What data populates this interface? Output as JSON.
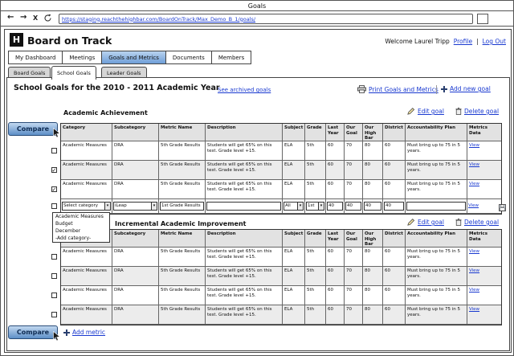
{
  "browser": {
    "window_title": "Goals",
    "url": "https://staging.reachthehighbar.com/BoardOnTrack/Max_Demo_B_1/goals/",
    "back_glyph": "←",
    "forward_glyph": "→",
    "close_glyph": "X"
  },
  "header": {
    "logo": "H",
    "app_title": "Board on Track",
    "welcome": "Welcome Laurel Tripp",
    "profile": "Profile",
    "separator": "|",
    "logout": "Log Out"
  },
  "nav": {
    "items": [
      {
        "label": "My Dashboard",
        "active": false
      },
      {
        "label": "Meetings",
        "active": false
      },
      {
        "label": "Goals and Metrics",
        "active": true
      },
      {
        "label": "Documents",
        "active": false
      },
      {
        "label": "Members",
        "active": false
      }
    ]
  },
  "subtabs": {
    "items": [
      {
        "label": "Board Goals",
        "active": false
      },
      {
        "label": "School Goals",
        "active": true
      },
      {
        "label": "Leader Goals",
        "active": false
      }
    ]
  },
  "page": {
    "title": "School Goals for the 2010 - 2011 Academic Year",
    "archived_link": "See archived goals",
    "print_link": "Print Goals and Metrics",
    "add_goal_link": "Add new goal"
  },
  "columns": [
    "Category",
    "Subcategory",
    "Metric Name",
    "Description",
    "Subject",
    "Grade",
    "Last Year",
    "Our Goal",
    "Our High Bar",
    "District",
    "Accountability Plan",
    "Metrics Data"
  ],
  "sections": [
    {
      "title": "Academic Achievement",
      "edit_link": "Edit goal",
      "delete_link": "Delete goal",
      "checks": [
        false,
        true,
        true,
        false
      ],
      "rows": [
        {
          "cells": [
            "Academic Measures",
            "DRA",
            "5th Grade Results",
            "Students will get 65% on this test. Grade level +15.",
            "ELA",
            "5th",
            "60",
            "70",
            "80",
            "60",
            "Must bring up to 75 in 5 years.",
            "View"
          ]
        },
        {
          "cells": [
            "Academic Measures",
            "DRA",
            "5th Grade Results",
            "Students will get 65% on this test. Grade level +15.",
            "ELA",
            "5th",
            "60",
            "70",
            "80",
            "60",
            "Must bring up to 75 in 5 years.",
            "View"
          ]
        },
        {
          "cells": [
            "Academic Measures",
            "DRA",
            "5th Grade Results",
            "Students will get 65% on this test. Grade level +15.",
            "ELA",
            "5th",
            "60",
            "70",
            "80",
            "60",
            "Must bring up to 75 in 5 years.",
            "View"
          ]
        }
      ]
    },
    {
      "title": "Incremental Academic Improvement",
      "edit_link": "Edit goal",
      "delete_link": "Delete goal",
      "checks": [
        false,
        false,
        false,
        false
      ],
      "rows": [
        {
          "cells": [
            "Academic Measures",
            "DRA",
            "5th Grade Results",
            "Students will get 65% on this test. Grade level +15.",
            "ELA",
            "5th",
            "60",
            "70",
            "80",
            "60",
            "Must bring up to 75 in 5 years.",
            "View"
          ]
        },
        {
          "cells": [
            "Academic Measures",
            "DRA",
            "5th Grade Results",
            "Students will get 65% on this test. Grade level +15.",
            "ELA",
            "5th",
            "60",
            "70",
            "80",
            "60",
            "Must bring up to 75 in 5 years.",
            "View"
          ]
        },
        {
          "cells": [
            "Academic Measures",
            "DRA",
            "5th Grade Results",
            "Students will get 65% on this test. Grade level +15.",
            "ELA",
            "5th",
            "60",
            "70",
            "80",
            "60",
            "Must bring up to 75 in 5 years.",
            "View"
          ]
        },
        {
          "cells": [
            "Academic Measures",
            "DRA",
            "5th Grade Results",
            "Students will get 65% on this test. Grade level +15.",
            "ELA",
            "5th",
            "60",
            "70",
            "80",
            "60",
            "Must bring up to 75 in 5 years.",
            "View"
          ]
        }
      ]
    }
  ],
  "edit_row": {
    "category": "Select category",
    "subcategory": "iLeap",
    "metric_name": "1st Grade Results",
    "description": "",
    "subject": "All",
    "grade": "1st",
    "last_year": "40",
    "our_goal": "40",
    "our_high_bar": "40",
    "district": "40",
    "accountability": "",
    "metrics": "View"
  },
  "category_dropdown": {
    "options": [
      "Academic Measures",
      "Budget",
      "December",
      "-Add category-"
    ]
  },
  "actions": {
    "compare": "Compare",
    "add_metric": "Add metric"
  },
  "colors": {
    "accent_blue": "#6f9ed8",
    "link_blue": "#1939d0"
  }
}
